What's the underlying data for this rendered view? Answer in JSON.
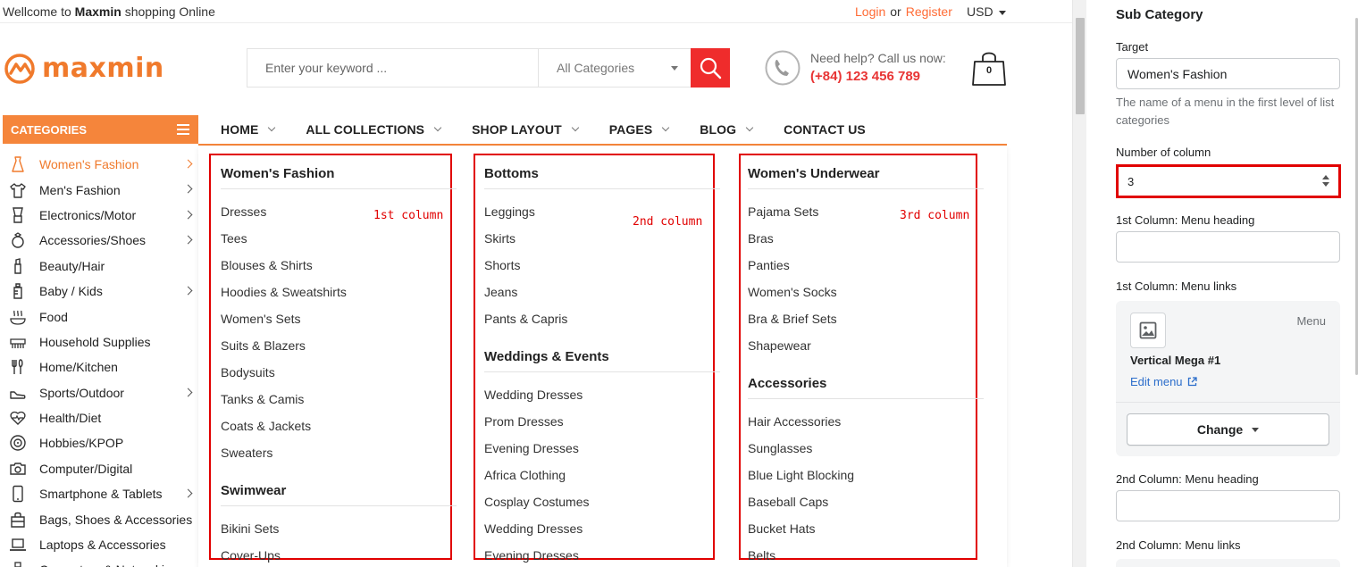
{
  "topbar": {
    "welcome_prefix": "Wellcome to",
    "brand": "Maxmin",
    "welcome_suffix": "shopping Online",
    "login": "Login",
    "or": "or",
    "register": "Register",
    "currency": "USD"
  },
  "logo": {
    "text": "maxmin",
    "color": "#f07a2c"
  },
  "search": {
    "placeholder": "Enter your keyword ...",
    "category": "All Categories",
    "button_icon": "search-icon",
    "button_color": "#ef2c2c"
  },
  "help": {
    "line1": "Need help? Call us now:",
    "phone": "(+84) 123 456 789"
  },
  "cart": {
    "count": "0"
  },
  "categories": {
    "title": "CATEGORIES",
    "items": [
      {
        "label": "Women's Fashion",
        "icon": "dress-icon",
        "active": true,
        "has_sub": true
      },
      {
        "label": "Men's Fashion",
        "icon": "shirt-icon",
        "has_sub": true
      },
      {
        "label": "Electronics/Motor",
        "icon": "blender-icon",
        "has_sub": true
      },
      {
        "label": "Accessories/Shoes",
        "icon": "ring-icon",
        "has_sub": true
      },
      {
        "label": "Beauty/Hair",
        "icon": "lipstick-icon",
        "has_sub": false
      },
      {
        "label": "Baby / Kids",
        "icon": "bottle-icon",
        "has_sub": true
      },
      {
        "label": "Food",
        "icon": "food-icon",
        "has_sub": false
      },
      {
        "label": "Household Supplies",
        "icon": "comb-icon",
        "has_sub": false
      },
      {
        "label": "Home/Kitchen",
        "icon": "utensils-icon",
        "has_sub": false
      },
      {
        "label": "Sports/Outdoor",
        "icon": "shoe-icon",
        "has_sub": true
      },
      {
        "label": "Health/Diet",
        "icon": "heart-pulse-icon",
        "has_sub": false
      },
      {
        "label": "Hobbies/KPOP",
        "icon": "disc-icon",
        "has_sub": false
      },
      {
        "label": "Computer/Digital",
        "icon": "camera-icon",
        "has_sub": false
      },
      {
        "label": "Smartphone & Tablets",
        "icon": "phone-icon",
        "has_sub": true
      },
      {
        "label": "Bags, Shoes & Accessories",
        "icon": "bag-icon",
        "has_sub": false
      },
      {
        "label": "Laptops & Accessories",
        "icon": "laptop-icon",
        "has_sub": false
      },
      {
        "label": "Computers & Networking",
        "icon": "network-icon",
        "has_sub": false
      }
    ]
  },
  "nav": {
    "items": [
      {
        "label": "HOME",
        "dropdown": true
      },
      {
        "label": "ALL COLLECTIONS",
        "dropdown": true
      },
      {
        "label": "SHOP LAYOUT",
        "dropdown": true
      },
      {
        "label": "PAGES",
        "dropdown": true
      },
      {
        "label": "BLOG",
        "dropdown": true
      },
      {
        "label": "CONTACT US",
        "dropdown": false
      }
    ]
  },
  "mega": {
    "columns": [
      {
        "annotation": "1st column",
        "groups": [
          {
            "heading": "Women's Fashion",
            "links": [
              "Dresses",
              "Tees",
              "Blouses & Shirts",
              "Hoodies & Sweatshirts",
              "Women's Sets",
              "Suits & Blazers",
              "Bodysuits",
              "Tanks & Camis",
              "Coats & Jackets",
              "Sweaters"
            ]
          },
          {
            "heading": "Swimwear",
            "links": [
              "Bikini Sets",
              "Cover-Ups"
            ]
          }
        ]
      },
      {
        "annotation": "2nd column",
        "groups": [
          {
            "heading": "Bottoms",
            "links": [
              "Leggings",
              "Skirts",
              "Shorts",
              "Jeans",
              "Pants & Capris"
            ]
          },
          {
            "heading": "Weddings & Events",
            "links": [
              "Wedding Dresses",
              "Prom Dresses",
              "Evening Dresses",
              "Africa Clothing",
              "Cosplay Costumes",
              "Wedding Dresses",
              "Evening Dresses"
            ]
          }
        ]
      },
      {
        "annotation": "3rd column",
        "groups": [
          {
            "heading": "Women's Underwear",
            "links": [
              "Pajama Sets",
              "Bras",
              "Panties",
              "Women's Socks",
              "Bra & Brief Sets",
              "Shapewear"
            ]
          },
          {
            "heading": "Accessories",
            "links": [
              "Hair Accessories",
              "Sunglasses",
              "Blue Light Blocking",
              "Baseball Caps",
              "Bucket Hats",
              "Belts"
            ]
          }
        ]
      }
    ]
  },
  "panel": {
    "title": "Sub Category",
    "target_label": "Target",
    "target_value": "Women's Fashion",
    "target_help": "The name of a menu in the first level of list categories",
    "columns_label": "Number of column",
    "columns_value": "3",
    "col1_heading_label": "1st Column: Menu heading",
    "col1_heading_value": "",
    "col1_links_label": "1st Column: Menu links",
    "menu_type": "Menu",
    "menu_name": "Vertical Mega #1",
    "edit_menu": "Edit menu",
    "change_button": "Change",
    "col2_heading_label": "2nd Column: Menu heading",
    "col2_heading_value": "",
    "col2_links_label": "2nd Column: Menu links"
  },
  "colors": {
    "accent": "#f5853b",
    "annotation": "#e10000",
    "link": "#2c6ecb"
  }
}
